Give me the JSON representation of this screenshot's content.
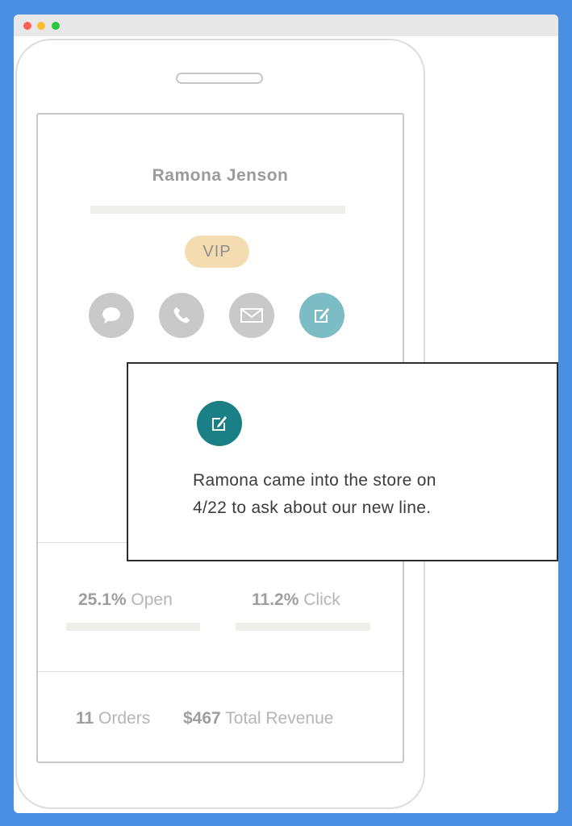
{
  "profile": {
    "name": "Ramona Jenson",
    "badge": "VIP"
  },
  "actions": [
    {
      "icon": "chat-bubble-icon"
    },
    {
      "icon": "phone-icon"
    },
    {
      "icon": "mail-icon"
    },
    {
      "icon": "note-edit-icon",
      "active": true
    }
  ],
  "note_popup": {
    "icon": "note-edit-icon",
    "text_line1": "Ramona came into the store on",
    "text_line2": "4/22 to ask about our new line."
  },
  "stats": {
    "open_value": "25.1%",
    "open_label": "Open",
    "click_value": "11.2%",
    "click_label": "Click",
    "orders_value": "11",
    "orders_label": "Orders",
    "revenue_value": "$467",
    "revenue_label": "Total Revenue"
  },
  "colors": {
    "background": "#4a90e2",
    "badge": "#f3ddb0",
    "note_active": "#7cbcc4",
    "note_popup_icon": "#1b7f86",
    "icon_inactive": "#c9c9c9"
  }
}
